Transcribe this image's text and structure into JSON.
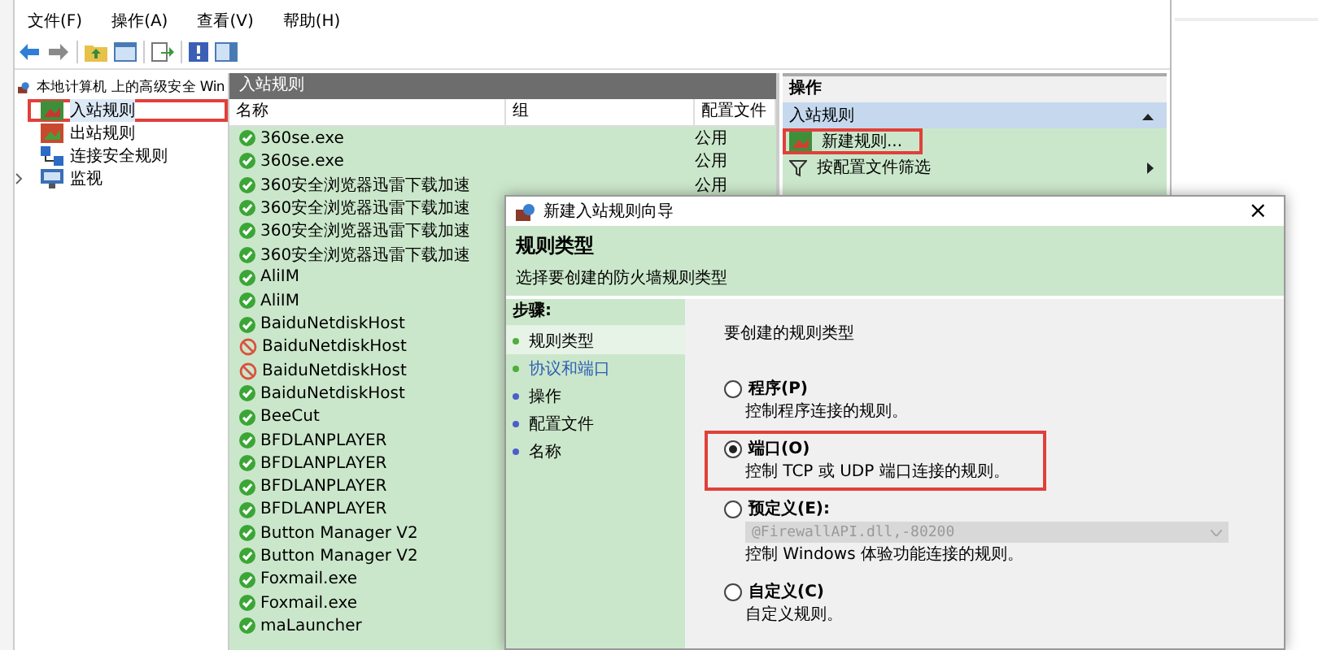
{
  "menu": [
    "文件(F)",
    "操作(A)",
    "查看(V)",
    "帮助(H)"
  ],
  "tree": {
    "label": "本地计算机 上的高级安全 Win",
    "children": [
      {
        "label": "入站规则",
        "kind": "inbound",
        "selected": true,
        "highlighted": true
      },
      {
        "label": "出站规则",
        "kind": "outbound",
        "selected": false,
        "highlighted": false
      },
      {
        "label": "连接安全规则",
        "kind": "security",
        "selected": false,
        "highlighted": false
      },
      {
        "label": "监视",
        "kind": "monitor",
        "selected": false,
        "highlighted": false,
        "expanded": false
      }
    ]
  },
  "rules": {
    "title": "入站规则",
    "columns": [
      "名称",
      "组",
      "配置文件"
    ],
    "rows": [
      {
        "name": "360se.exe",
        "kind": "allow",
        "profile": "公用"
      },
      {
        "name": "360se.exe",
        "kind": "allow",
        "profile": "公用"
      },
      {
        "name": "360安全浏览器迅雷下载加速",
        "kind": "allow",
        "profile": "公用"
      },
      {
        "name": "360安全浏览器迅雷下载加速",
        "kind": "allow"
      },
      {
        "name": "360安全浏览器迅雷下载加速",
        "kind": "allow"
      },
      {
        "name": "360安全浏览器迅雷下载加速",
        "kind": "allow"
      },
      {
        "name": "AliIM",
        "kind": "allow"
      },
      {
        "name": "AliIM",
        "kind": "allow"
      },
      {
        "name": "BaiduNetdiskHost",
        "kind": "allow"
      },
      {
        "name": "BaiduNetdiskHost",
        "kind": "block"
      },
      {
        "name": "BaiduNetdiskHost",
        "kind": "block"
      },
      {
        "name": "BaiduNetdiskHost",
        "kind": "allow"
      },
      {
        "name": "BeeCut",
        "kind": "allow"
      },
      {
        "name": "BFDLANPLAYER",
        "kind": "allow"
      },
      {
        "name": "BFDLANPLAYER",
        "kind": "allow"
      },
      {
        "name": "BFDLANPLAYER",
        "kind": "allow"
      },
      {
        "name": "BFDLANPLAYER",
        "kind": "allow"
      },
      {
        "name": "Button Manager V2",
        "kind": "allow"
      },
      {
        "name": "Button Manager V2",
        "kind": "allow"
      },
      {
        "name": "Foxmail.exe",
        "kind": "allow"
      },
      {
        "name": "Foxmail.exe",
        "kind": "allow"
      },
      {
        "name": "maLauncher",
        "kind": "allow"
      }
    ]
  },
  "actions": {
    "title": "操作",
    "section": "入站规则",
    "items": [
      {
        "label": "新建规则...",
        "kind": "new",
        "highlighted": true,
        "submenu": false
      },
      {
        "label": "按配置文件筛选",
        "kind": "filter",
        "highlighted": false,
        "submenu": true
      }
    ]
  },
  "dialog": {
    "title": "新建入站规则向导",
    "close": "×",
    "heading": "规则类型",
    "subheading": "选择要创建的防火墙规则类型",
    "steps_title": "步骤:",
    "steps": [
      {
        "label": "规则类型",
        "selected": true,
        "link": false,
        "color": "#4caf3c"
      },
      {
        "label": "协议和端口",
        "selected": false,
        "link": true,
        "color": "#4caf3c"
      },
      {
        "label": "操作",
        "selected": false,
        "link": false,
        "color": "#4a5fc8"
      },
      {
        "label": "配置文件",
        "selected": false,
        "link": false,
        "color": "#4a5fc8"
      },
      {
        "label": "名称",
        "selected": false,
        "link": false,
        "color": "#4a5fc8"
      }
    ],
    "prompt": "要创建的规则类型",
    "options": [
      {
        "label": "程序(P)",
        "description": "控制程序连接的规则。",
        "selected": false,
        "highlighted": false
      },
      {
        "label": "端口(O)",
        "description": "控制 TCP 或 UDP 端口连接的规则。",
        "selected": true,
        "highlighted": true
      },
      {
        "label": "预定义(E):",
        "dropdown": {
          "value": "@FirewallAPI.dll,-80200",
          "disabled": true
        },
        "description": "控制 Windows 体验功能连接的规则。",
        "selected": false,
        "highlighted": false
      },
      {
        "label": "自定义(C)",
        "description": "自定义规则。",
        "selected": false,
        "highlighted": false
      }
    ]
  }
}
